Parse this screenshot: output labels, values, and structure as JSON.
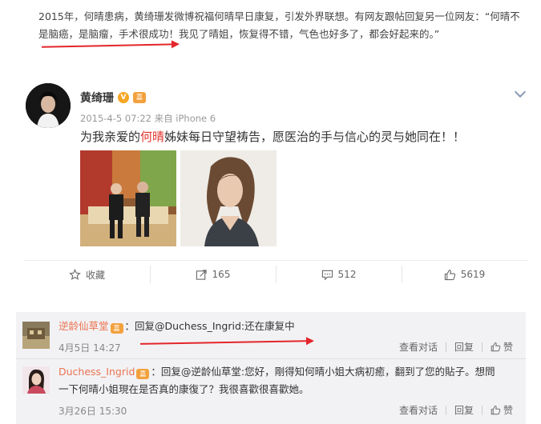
{
  "article": {
    "line1": "2015年，何晴患病，黄绮珊发微博祝福何晴早日康复，引发外界联想。有网友跟帖回复另一位网友：“何晴不",
    "line2": "是脑癌，是脑瘤，手术很成功！我见了晴姐，恢复得不错，气色也好多了，都会好起来的。”"
  },
  "post": {
    "username": "黄绮珊",
    "verified": "V",
    "medal": "嘉",
    "meta": "2015-4-5 07:22 来自 iPhone 6",
    "content_before": "为我亲爱的",
    "content_highlight": "何晴",
    "content_after": "姊妹每日守望祷告，愿医治的手与信心的灵与她同在！！",
    "actions": {
      "collect": "收藏",
      "repost": "165",
      "comment": "512",
      "like": "5619"
    }
  },
  "comments": [
    {
      "name": "逆龄仙草堂",
      "medal": "嘉",
      "text": "：回复@Duchess_Ingrid:还在康复中",
      "time": "4月5日 14:27",
      "view": "查看对话",
      "reply": "回复",
      "like": "赞"
    },
    {
      "name": "Duchess_Ingrid",
      "medal": "嘉",
      "text": "：回复@逆龄仙草堂:您好，剛得知何晴小姐大病初癒，翻到了您的貼子。想問",
      "text2": "一下何晴小姐現在是否真的康復了？我很喜歡很喜歡她。",
      "time": "3月26日 15:30",
      "view": "查看对话",
      "reply": "回复",
      "like": "赞"
    }
  ],
  "colors": {
    "arrow": "#e3262b",
    "highlight": "#e2352c",
    "comment_name": "#eb7350",
    "comment_bg": "#f2f2f5"
  }
}
